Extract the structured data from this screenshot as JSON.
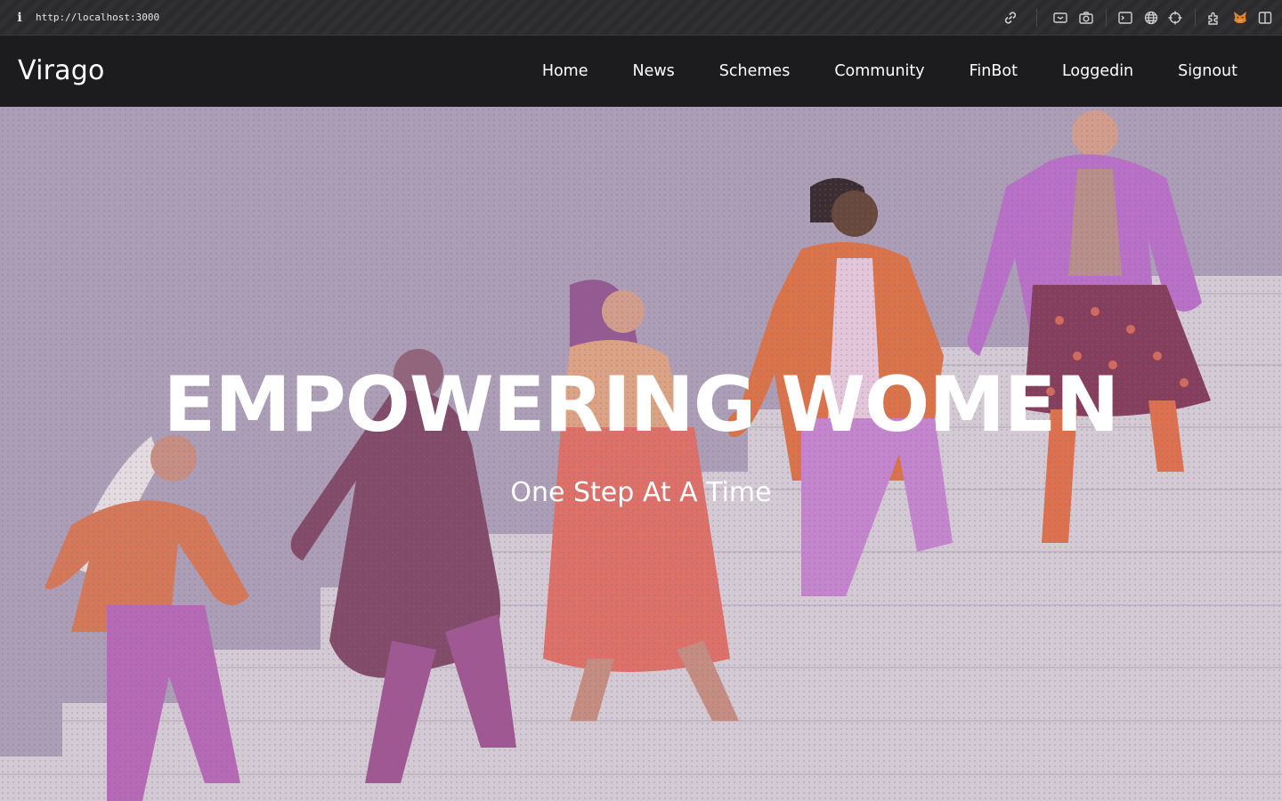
{
  "browser": {
    "url": "http://localhost:3000",
    "info_icon": "info-icon",
    "toolbar_icons": [
      "link-icon",
      "screencast-icon",
      "camera-icon",
      "terminal-icon",
      "globe-icon",
      "crosshair-icon",
      "extensions-icon",
      "metamask-fox-icon",
      "sidebar-toggle-icon"
    ]
  },
  "header": {
    "brand": "Virago",
    "nav": [
      {
        "label": "Home"
      },
      {
        "label": "News"
      },
      {
        "label": "Schemes"
      },
      {
        "label": "Community"
      },
      {
        "label": "FinBot"
      },
      {
        "label": "Loggedin"
      },
      {
        "label": "Signout"
      }
    ]
  },
  "hero": {
    "title": "EMPOWERING WOMEN",
    "subtitle": "One Step At A Time",
    "image_subject": "illustration-women-holding-hands-climbing-stairs"
  },
  "colors": {
    "header_bg": "#1c1b1d",
    "hero_bg": "#aa9cb6",
    "text": "#ffffff"
  }
}
